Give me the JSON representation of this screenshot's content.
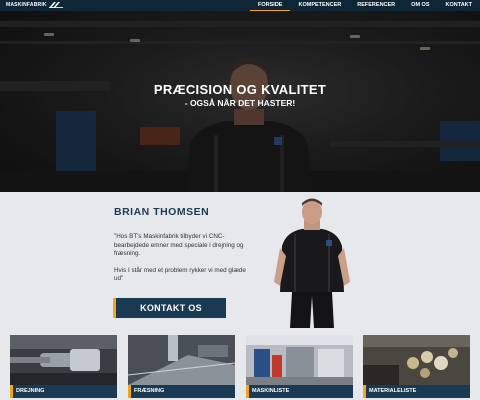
{
  "nav": {
    "logo_text": "MASKINFABRIK",
    "items": [
      "FORSIDE",
      "KOMPETENCER",
      "REFERENCER",
      "OM OS",
      "KONTAKT"
    ]
  },
  "hero": {
    "title": "PRÆCISION OG KVALITET",
    "subtitle": "- OGSÅ NÅR DET HASTER!"
  },
  "profile": {
    "name": "BRIAN THOMSEN",
    "quote_1": "\"Hos BT's Maskinfabrik tilbyder vi CNC-bearbejdede emner med speciale i drejning og fræsning.",
    "quote_2": "Hvis I står med et problem rykker vi med glæde ud\"",
    "contact_button": "KONTAKT OS"
  },
  "cards": [
    "DREJNING",
    "FRÆSNING",
    "MASKINLISTE",
    "MATERIALELISTE"
  ],
  "colors": {
    "navy": "#1a3a54",
    "accent": "#f2a51d",
    "nav_bg": "#0f2636"
  }
}
